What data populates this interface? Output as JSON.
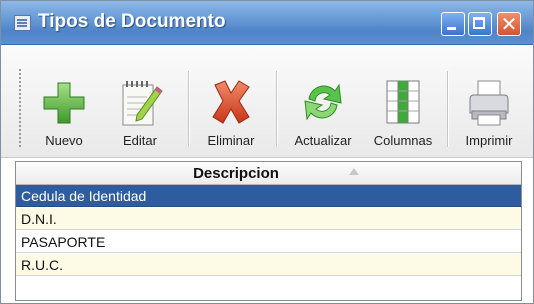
{
  "window": {
    "title": "Tipos de Documento",
    "close_glyph": "✕",
    "colors": {
      "titlebar": "#5d8fd0",
      "close": "#d4532d",
      "selected_row": "#2e5c9e"
    }
  },
  "toolbar": {
    "buttons": [
      {
        "label": "Nuevo",
        "icon": "plus-icon"
      },
      {
        "label": "Editar",
        "icon": "notepad-pencil-icon"
      },
      {
        "label": "Eliminar",
        "icon": "red-x-icon"
      },
      {
        "label": "Actualizar",
        "icon": "green-refresh-icon"
      },
      {
        "label": "Columnas",
        "icon": "columns-icon"
      },
      {
        "label": "Imprimir",
        "icon": "printer-icon"
      }
    ]
  },
  "grid": {
    "column": "Descripcion",
    "sort": "ascending",
    "rows": [
      "Cedula de Identidad",
      "D.N.I.",
      "PASAPORTE",
      "R.U.C."
    ],
    "selected_index": 0
  }
}
